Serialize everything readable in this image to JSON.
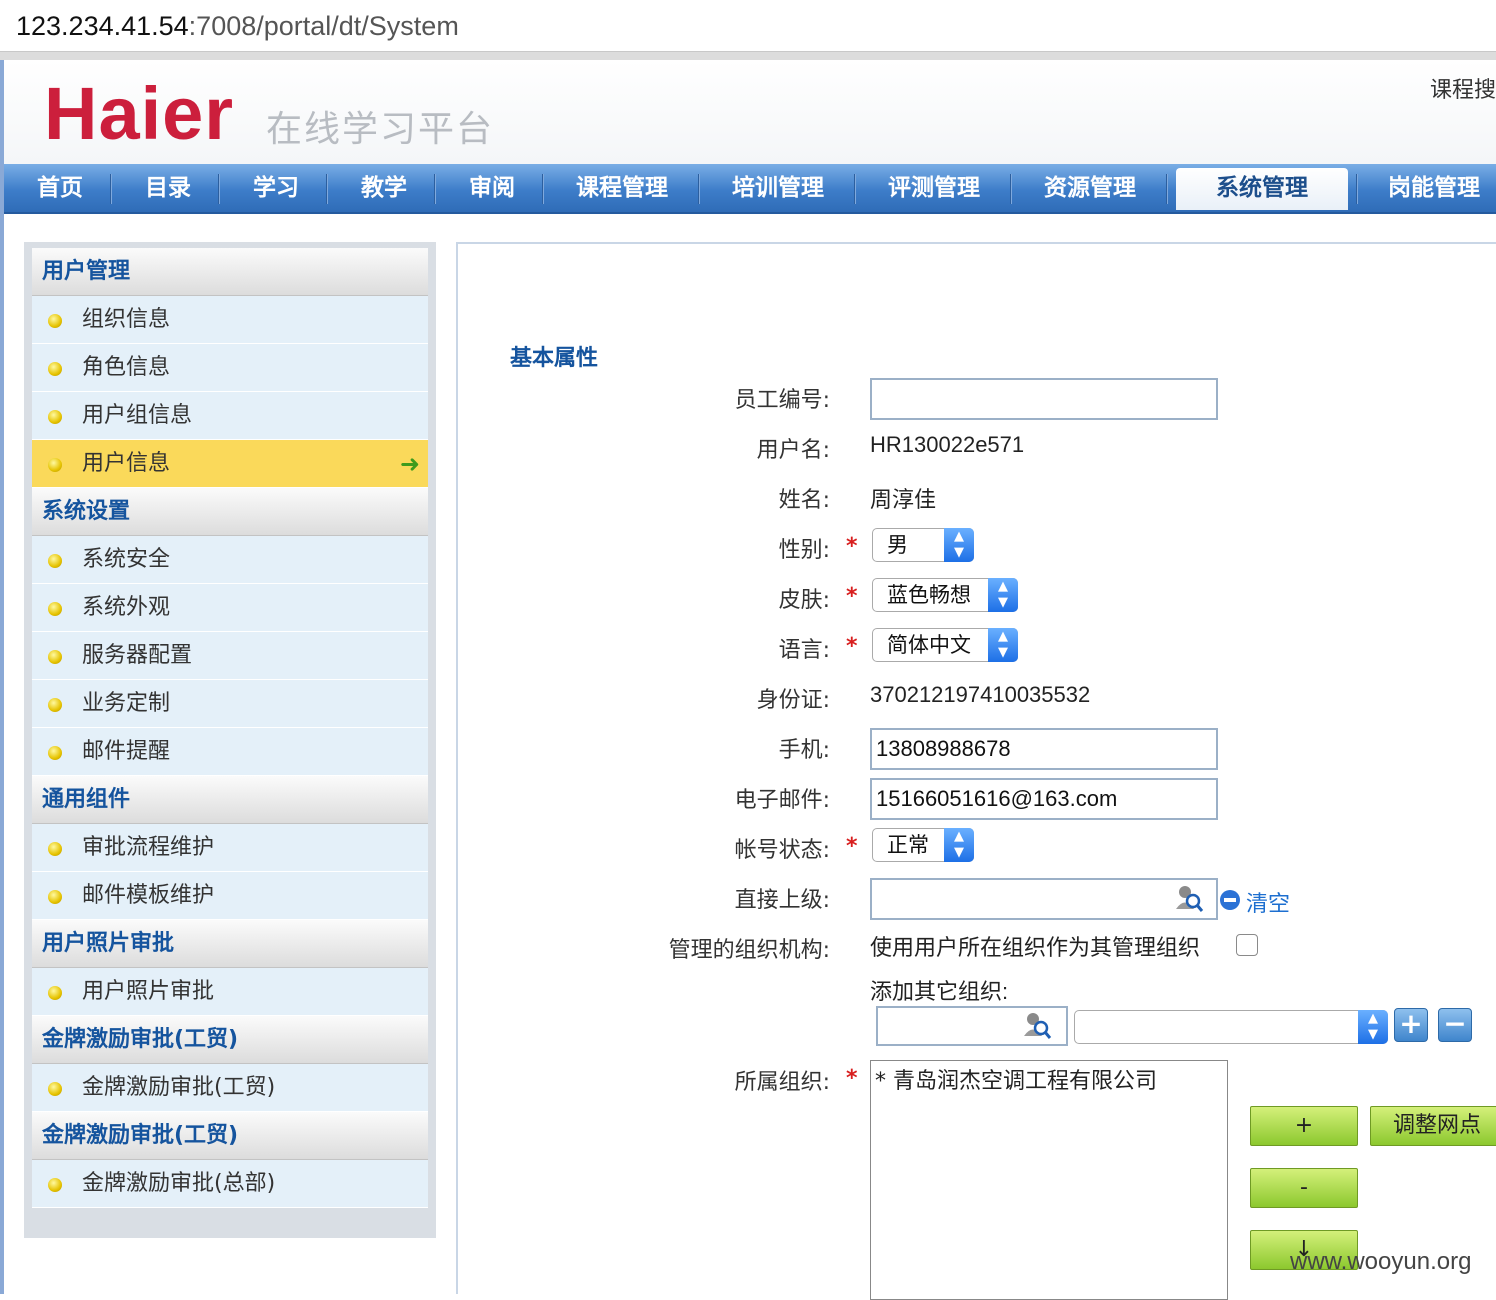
{
  "browser": {
    "url_host": "123.234.41.54",
    "url_path": ":7008/portal/dt/System"
  },
  "header": {
    "logo": "Haier",
    "slogan": "在线学习平台",
    "top_right": "课程搜"
  },
  "nav": [
    "首页",
    "目录",
    "学习",
    "教学",
    "审阅",
    "课程管理",
    "培训管理",
    "评测管理",
    "资源管理",
    "系统管理",
    "岗能管理"
  ],
  "nav_active": "系统管理",
  "sidebar": {
    "groups": [
      {
        "title": "用户管理",
        "items": [
          "组织信息",
          "角色信息",
          "用户组信息",
          "用户信息"
        ]
      },
      {
        "title": "系统设置",
        "items": [
          "系统安全",
          "系统外观",
          "服务器配置",
          "业务定制",
          "邮件提醒"
        ]
      },
      {
        "title": "通用组件",
        "items": [
          "审批流程维护",
          "邮件模板维护"
        ]
      },
      {
        "title": "用户照片审批",
        "items": [
          "用户照片审批"
        ]
      },
      {
        "title": "金牌激励审批(工贸)",
        "items": [
          "金牌激励审批(工贸)"
        ]
      },
      {
        "title": "金牌激励审批(工贸)",
        "items": [
          "金牌激励审批(总部)"
        ]
      }
    ],
    "active_item": "用户信息"
  },
  "form": {
    "section_title": "基本属性",
    "employee_id": {
      "label": "员工编号:",
      "value": ""
    },
    "username": {
      "label": "用户名:",
      "value": "HR130022e571"
    },
    "name": {
      "label": "姓名:",
      "value": "周淳佳"
    },
    "gender": {
      "label": "性别:",
      "value": "男"
    },
    "skin": {
      "label": "皮肤:",
      "value": "蓝色畅想"
    },
    "language": {
      "label": "语言:",
      "value": "简体中文"
    },
    "id_card": {
      "label": "身份证:",
      "value": "370212197410035532"
    },
    "mobile": {
      "label": "手机:",
      "value": "13808988678"
    },
    "email": {
      "label": "电子邮件:",
      "value": "15166051616@163.com"
    },
    "account_status": {
      "label": "帐号状态:",
      "value": "正常"
    },
    "supervisor": {
      "label": "直接上级:",
      "value": "",
      "clear_label": "清空"
    },
    "managed_orgs": {
      "label": "管理的组织机构:",
      "checkbox_text": "使用用户所在组织作为其管理组织",
      "add_other": "添加其它组织:"
    },
    "belong_org": {
      "label": "所属组织:",
      "items": [
        "* 青岛润杰空调工程有限公司"
      ]
    },
    "required_mark": "*",
    "buttons": {
      "add": "+",
      "remove": "-",
      "move_down": "↓",
      "adjust": "调整网点"
    }
  },
  "watermark": "www.wooyun.org"
}
